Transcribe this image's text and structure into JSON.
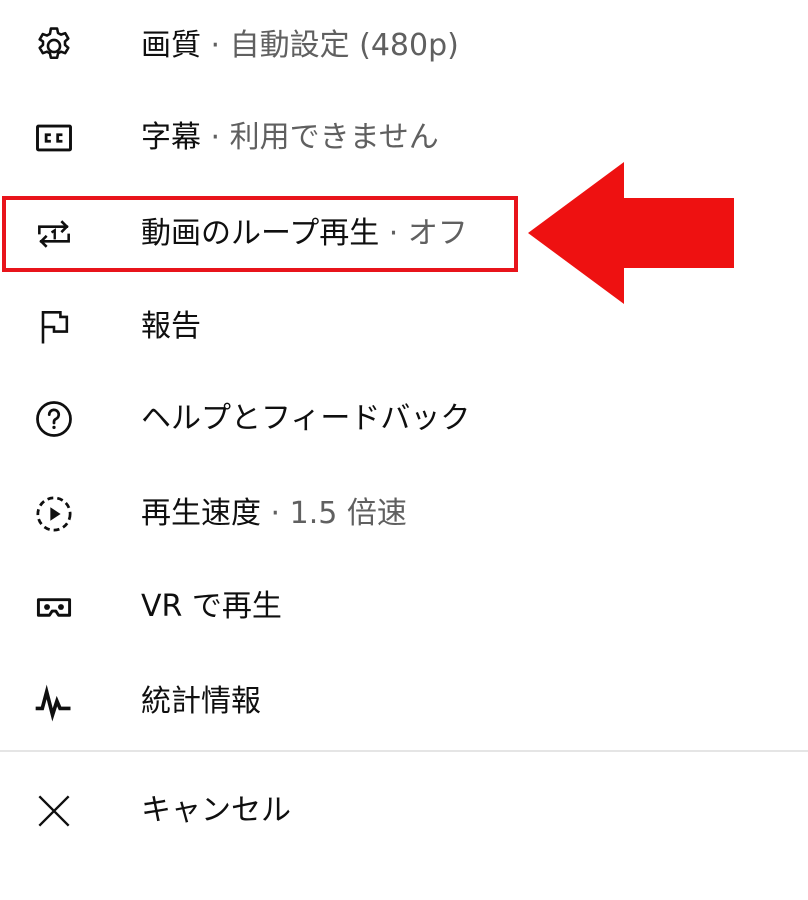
{
  "menu": {
    "items": [
      {
        "icon": "gear-icon",
        "label": "画質",
        "sep": " · ",
        "value": "自動設定 (480p)"
      },
      {
        "icon": "closed-captions-icon",
        "label": "字幕",
        "sep": " · ",
        "value": "利用できません"
      },
      {
        "icon": "loop-icon",
        "label": "動画のループ再生",
        "sep": " · ",
        "value": "オフ"
      },
      {
        "icon": "flag-icon",
        "label": "報告",
        "sep": "",
        "value": ""
      },
      {
        "icon": "help-icon",
        "label": "ヘルプとフィードバック",
        "sep": "",
        "value": ""
      },
      {
        "icon": "playback-speed-icon",
        "label": "再生速度",
        "sep": " · ",
        "value": "1.5 倍速"
      },
      {
        "icon": "vr-headset-icon",
        "label": "VR で再生",
        "sep": "",
        "value": ""
      },
      {
        "icon": "stats-icon",
        "label": "統計情報",
        "sep": "",
        "value": ""
      }
    ],
    "cancel": {
      "icon": "close-icon",
      "label": "キャンセル"
    }
  },
  "annotation": {
    "highlight_color": "#e8141b",
    "arrow_color": "#ee1111",
    "highlighted_item": "動画のループ再生"
  }
}
